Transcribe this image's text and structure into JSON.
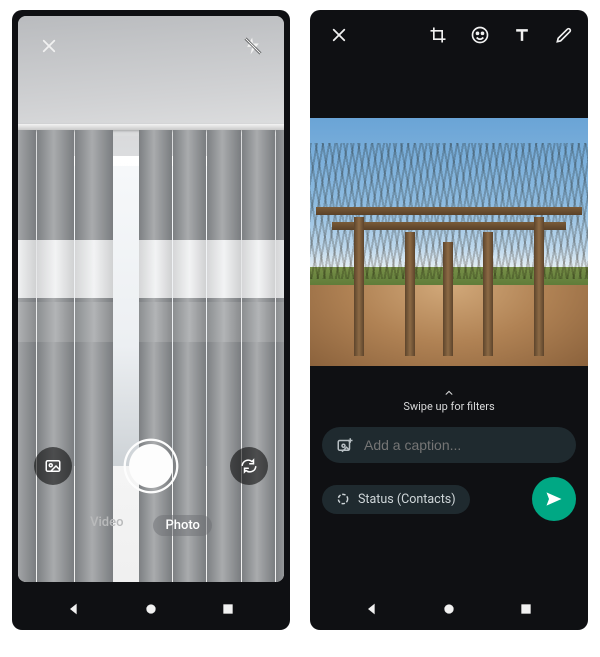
{
  "left": {
    "modes": {
      "video": "Video",
      "photo": "Photo"
    }
  },
  "right": {
    "swipe_hint": "Swipe up for filters",
    "caption_placeholder": "Add a caption...",
    "audience_label": "Status (Contacts)"
  }
}
